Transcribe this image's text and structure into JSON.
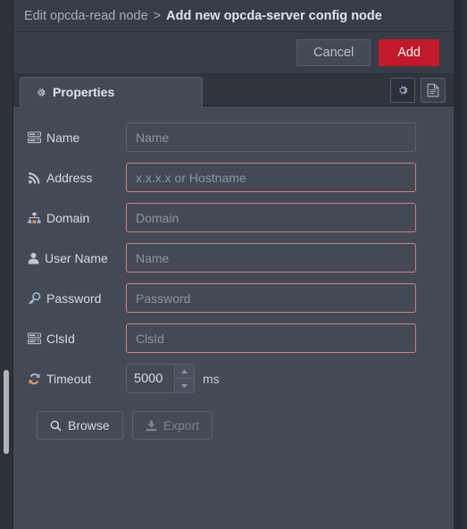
{
  "breadcrumb": {
    "previous": "Edit opcda-read node",
    "separator": ">",
    "current": "Add new opcda-server config node"
  },
  "actions": {
    "cancel_label": "Cancel",
    "add_label": "Add",
    "add_color": "#c4182b"
  },
  "tabs": {
    "properties": {
      "label": "Properties",
      "icon": "gear-icon"
    },
    "tools": [
      {
        "name": "gear-icon",
        "active": true
      },
      {
        "name": "description-icon",
        "active": false
      }
    ]
  },
  "form": {
    "fields": [
      {
        "id": "name",
        "icon": "server-icon",
        "label": "Name",
        "value": "",
        "placeholder": "Name",
        "invalid": false
      },
      {
        "id": "address",
        "icon": "signal-icon",
        "label": "Address",
        "value": "",
        "placeholder": "x.x.x.x or Hostname",
        "invalid": true
      },
      {
        "id": "domain",
        "icon": "sitemap-icon",
        "label": "Domain",
        "value": "",
        "placeholder": "Domain",
        "invalid": true
      },
      {
        "id": "username",
        "icon": "user-icon",
        "label": "User Name",
        "value": "",
        "placeholder": "Name",
        "invalid": true
      },
      {
        "id": "password",
        "icon": "key-icon",
        "label": "Password",
        "value": "",
        "placeholder": "Password",
        "invalid": true
      },
      {
        "id": "clsid",
        "icon": "server-icon",
        "label": "ClsId",
        "value": "",
        "placeholder": "ClsId",
        "invalid": true
      }
    ],
    "timeout": {
      "icon": "refresh-icon",
      "label": "Timeout",
      "value": "5000",
      "unit": "ms"
    }
  },
  "bottom_buttons": [
    {
      "id": "browse",
      "icon": "search-icon",
      "label": "Browse",
      "disabled": false
    },
    {
      "id": "export",
      "icon": "download-icon",
      "label": "Export",
      "disabled": true
    }
  ],
  "colors": {
    "panel": "#434a56",
    "chrome": "#373d48",
    "outer": "#2c313a",
    "invalid_border": "#d97c7c",
    "accent_red": "#c4182b"
  },
  "scrollbar": {
    "name": "vertical-scrollbar"
  }
}
